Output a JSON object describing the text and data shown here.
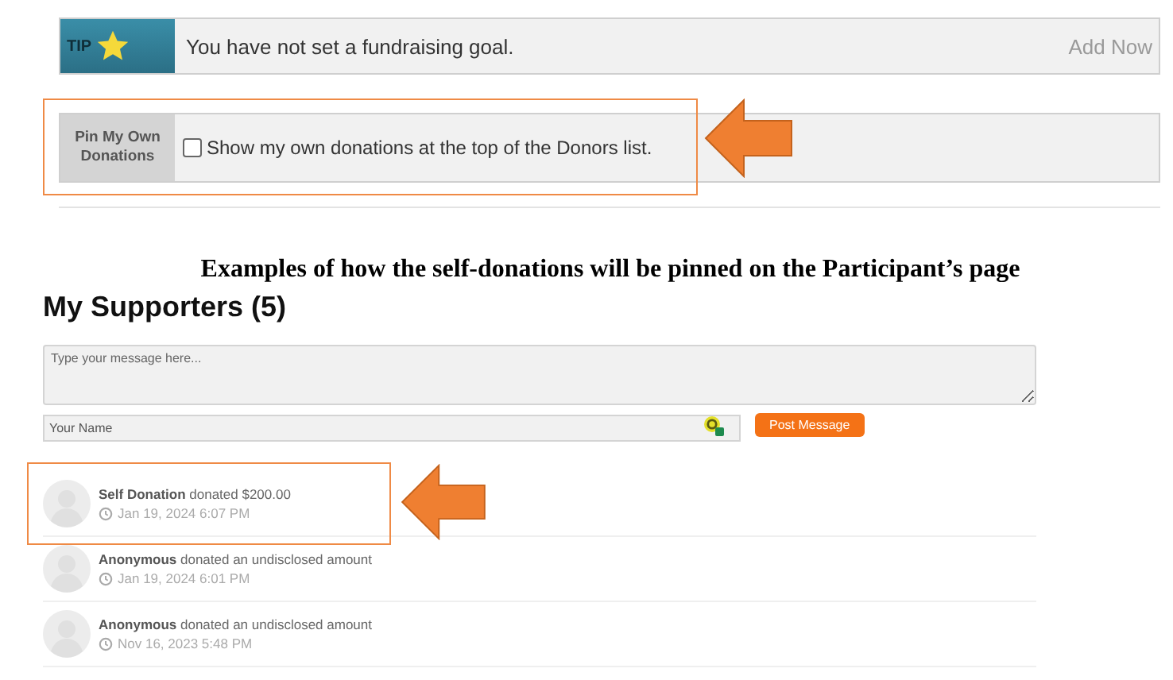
{
  "tip": {
    "badge": "TIP",
    "message": "You have not set a fundraising goal.",
    "action": "Add Now"
  },
  "pin_setting": {
    "label": "Pin My Own Donations",
    "checkbox_label": "Show my own donations at the top of the Donors list.",
    "checked": false
  },
  "caption": "Examples of how the self-donations will be pinned on the Participant’s page",
  "supporters": {
    "title": "My Supporters (5)",
    "message_field": {
      "placeholder": "Type your message here..."
    },
    "name_field": {
      "placeholder": "Your Name"
    },
    "post_button": "Post Message",
    "donors": [
      {
        "text": "**Self Donation** donated $200.00",
        "time": "Jan 19, 2024 6:07 PM"
      },
      {
        "text": "**Anonymous** donated an undisclosed amount",
        "time": "Jan 19, 2024 6:01 PM"
      },
      {
        "text": "**Anonymous** donated an undisclosed amount",
        "time": "Nov 16, 2023 5:48 PM"
      }
    ]
  }
}
